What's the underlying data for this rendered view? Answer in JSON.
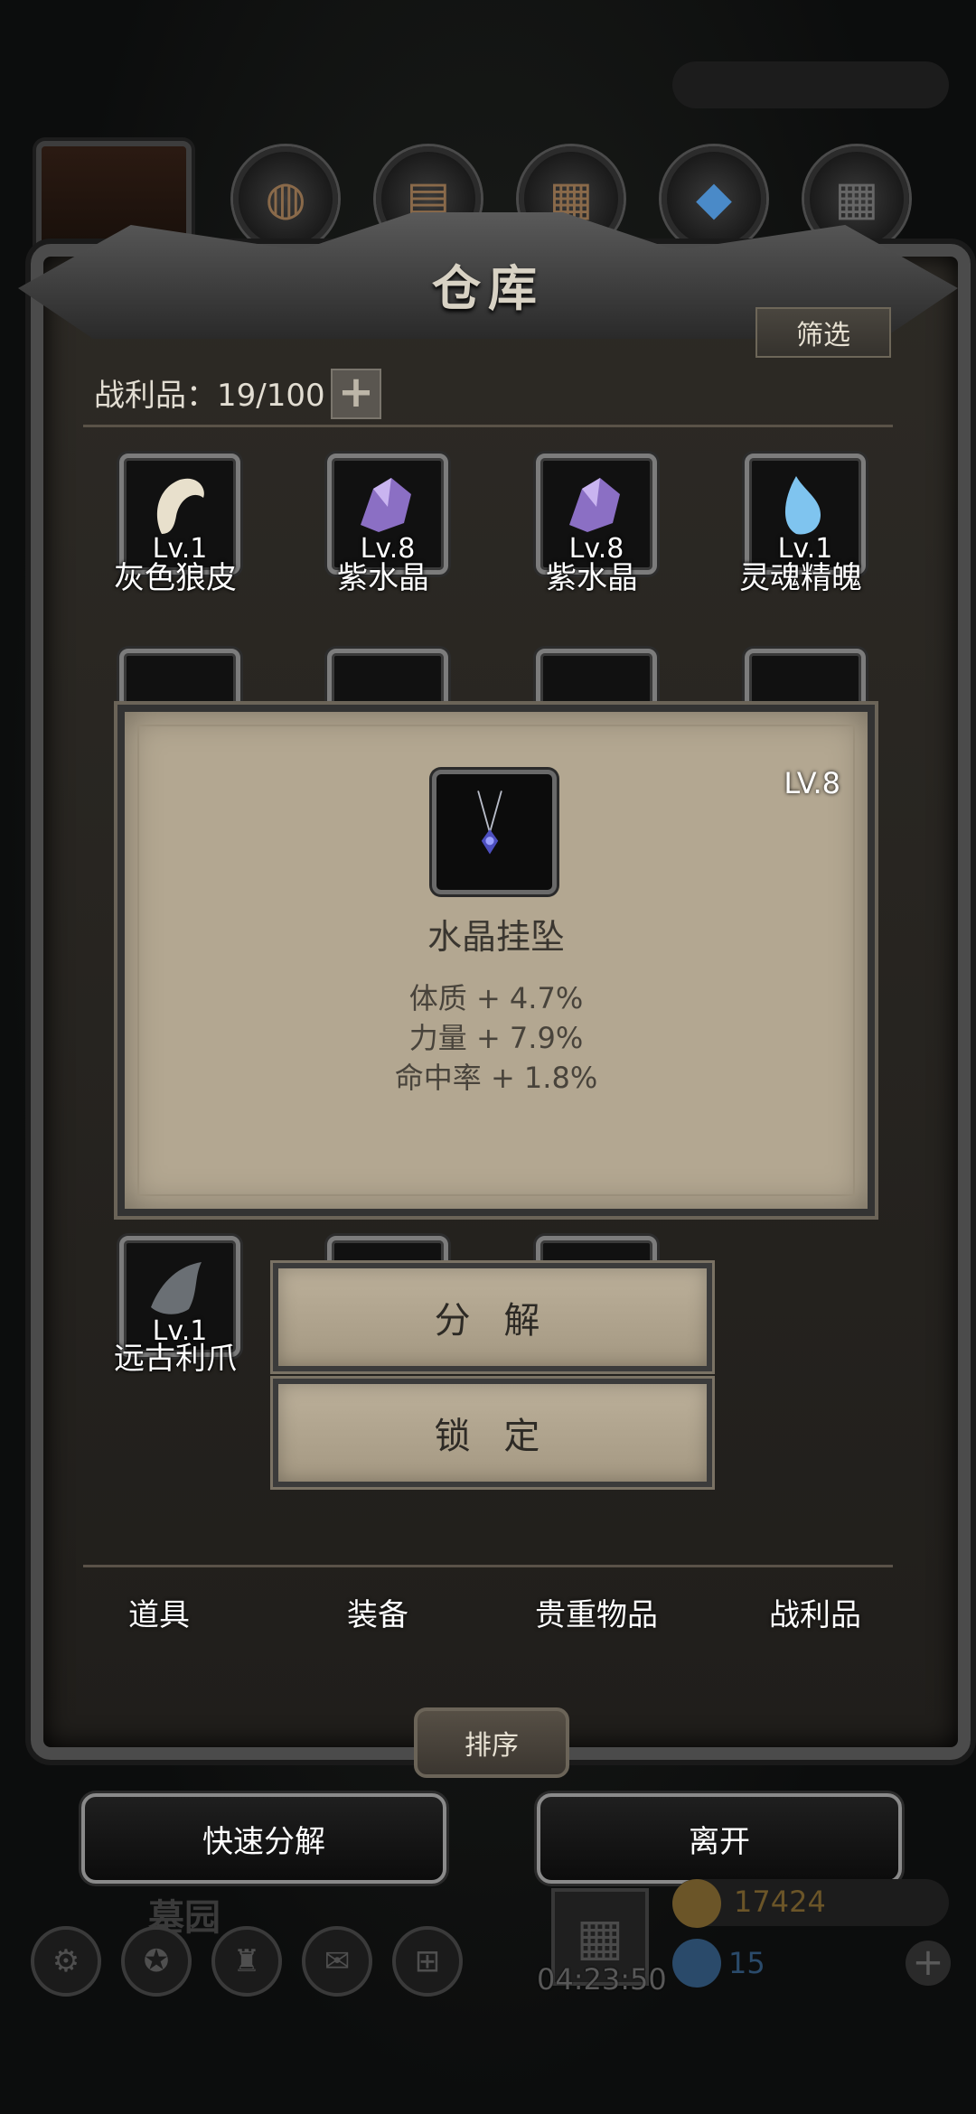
{
  "warehouse": {
    "title": "仓库",
    "filter_label": "筛选",
    "capacity_label": "战利品：19/100",
    "add_symbol": "+"
  },
  "top_icons": [
    "portrait-icon",
    "leather-icon",
    "wood-plank-icon",
    "iron-ingot-icon",
    "blue-crystal-icon",
    "dark-metal-icon"
  ],
  "items_row1": [
    {
      "name": "灰色狼皮",
      "level": "Lv.1",
      "icon": "wolf-pelt-icon"
    },
    {
      "name": "紫水晶",
      "level": "Lv.8",
      "icon": "amethyst-icon"
    },
    {
      "name": "紫水晶",
      "level": "Lv.8",
      "icon": "amethyst-icon"
    },
    {
      "name": "灵魂精魄",
      "level": "Lv.1",
      "icon": "soul-essence-icon"
    }
  ],
  "items_row3": [
    {
      "name": "远古利爪",
      "level": "Lv.1",
      "icon": "ancient-claw-icon"
    }
  ],
  "detail": {
    "level": "LV.8",
    "name": "水晶挂坠",
    "stats": [
      "体质 + 4.7%",
      "力量 + 7.9%",
      "命中率 + 1.8%"
    ],
    "icon": "crystal-pendant-icon"
  },
  "actions": {
    "decompose": "分 解",
    "lock": "锁 定"
  },
  "tabs": [
    "道具",
    "装备",
    "贵重物品",
    "战利品"
  ],
  "sort_label": "排序",
  "quick_decompose_label": "快速分解",
  "leave_label": "离开",
  "bottom": {
    "location": "墓园",
    "timer": "04:23:50",
    "gold": "17424",
    "gems": "15",
    "colors": {
      "gold": "#6b5528",
      "gem": "#2a4a6a"
    }
  }
}
